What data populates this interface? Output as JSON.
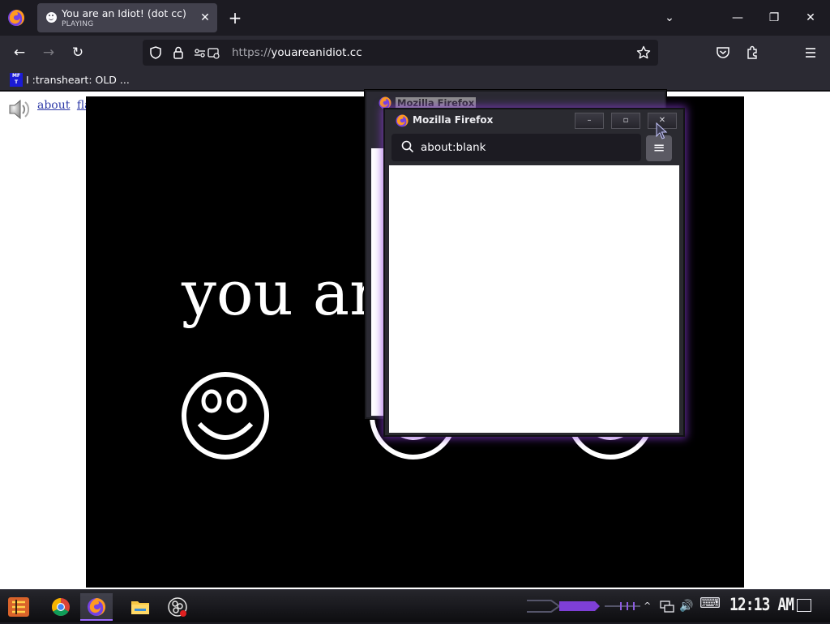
{
  "browser": {
    "tab": {
      "title": "You are an Idiot! (dot cc)",
      "status": "PLAYING",
      "close_glyph": "✕"
    },
    "new_tab_glyph": "+",
    "tab_list_glyph": "⌄",
    "window_controls": {
      "minimize": "—",
      "restore": "❐",
      "close": "✕"
    },
    "nav": {
      "back": "←",
      "forward": "→",
      "reload": "↻"
    },
    "url": {
      "scheme": "https://",
      "host": "youareanidiot.cc"
    },
    "url_icons": [
      "shield-icon",
      "lock-icon",
      "permissions-icon"
    ],
    "toolbar_icons": [
      "bookmark-star-icon",
      "pocket-icon",
      "extensions-icon",
      "menu-icon"
    ],
    "bookmark": {
      "icon_text": "MF T",
      "label": "I :transheart: OLD ..."
    }
  },
  "page": {
    "links": [
      "about",
      "flash"
    ],
    "stage_text": "you ar"
  },
  "popup_back": {
    "title": "Mozilla Firefox"
  },
  "popup": {
    "title": "Mozilla Firefox",
    "address": "about:blank",
    "buttons": {
      "minimize": "–",
      "maximize": "▫",
      "close": "✕"
    },
    "menu_glyph": "≡"
  },
  "taskbar": {
    "apps": [
      "start-icon",
      "chrome-icon",
      "firefox-icon",
      "file-explorer-icon",
      "obs-icon"
    ],
    "tray": {
      "chevron": "^",
      "volume": "🔊",
      "keyboard": "⌨"
    },
    "clock": "12:13 AM"
  },
  "colors": {
    "accent": "#8c3cdc",
    "chrome_dark": "#1c1b22",
    "chrome": "#2b2a33",
    "link": "#2f3ba8"
  }
}
